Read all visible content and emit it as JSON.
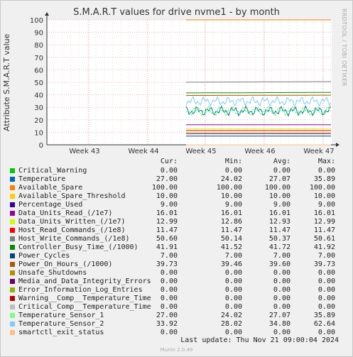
{
  "chart_data": {
    "type": "line",
    "title": "S.M.A.R.T values for drive nvme1 - by month",
    "ylabel": "Attribute S.M.A.R.T value",
    "ylim": [
      0,
      100
    ],
    "yticks": [
      0,
      10,
      20,
      30,
      40,
      50,
      60,
      70,
      80,
      90,
      100
    ],
    "xticks": [
      "Week 43",
      "Week 44",
      "Week 45",
      "Week 46",
      "Week 47"
    ],
    "grid": true,
    "sidelabel": "RRDTOOL / TOBI OETIKER",
    "legend_headers": {
      "cur": "Cur:",
      "min": "Min:",
      "avg": "Avg:",
      "max": "Max:"
    },
    "series": [
      {
        "name": "Critical_Warning",
        "color": "#00cc00",
        "cur": "0.00",
        "min": "0.00",
        "avg": "0.00",
        "max": "0.00"
      },
      {
        "name": "Temperature",
        "color": "#0066b3",
        "cur": "27.00",
        "min": "24.02",
        "avg": "27.07",
        "max": "35.89"
      },
      {
        "name": "Available_Spare",
        "color": "#ff8000",
        "cur": "100.00",
        "min": "100.00",
        "avg": "100.00",
        "max": "100.00"
      },
      {
        "name": "Available_Spare_Threshold",
        "color": "#ffcc00",
        "cur": "10.00",
        "min": "10.00",
        "avg": "10.00",
        "max": "10.00"
      },
      {
        "name": "Percentage_Used",
        "color": "#330099",
        "cur": "9.00",
        "min": "9.00",
        "avg": "9.00",
        "max": "9.00"
      },
      {
        "name": "Data_Units_Read_(/1e7)",
        "color": "#990099",
        "cur": "16.01",
        "min": "16.01",
        "avg": "16.01",
        "max": "16.01"
      },
      {
        "name": "Data_Units_Written_(/1e7)",
        "color": "#ccff00",
        "cur": "12.99",
        "min": "12.86",
        "avg": "12.93",
        "max": "12.99"
      },
      {
        "name": "Host_Read_Commands_(/1e8)",
        "color": "#ff0000",
        "cur": "11.47",
        "min": "11.47",
        "avg": "11.47",
        "max": "11.47"
      },
      {
        "name": "Host_Write_Commands_(/1e8)",
        "color": "#808080",
        "cur": "50.60",
        "min": "50.14",
        "avg": "50.37",
        "max": "50.61"
      },
      {
        "name": "Controller_Busy_Time_(/1000)",
        "color": "#008f00",
        "cur": "41.91",
        "min": "41.52",
        "avg": "41.72",
        "max": "41.92"
      },
      {
        "name": "Power_Cycles",
        "color": "#00487d",
        "cur": "7.00",
        "min": "7.00",
        "avg": "7.00",
        "max": "7.00"
      },
      {
        "name": "Power_On_Hours_(/1000)",
        "color": "#b35a00",
        "cur": "39.73",
        "min": "39.46",
        "avg": "39.60",
        "max": "39.73"
      },
      {
        "name": "Unsafe_Shutdowns",
        "color": "#b38f00",
        "cur": "0.00",
        "min": "0.00",
        "avg": "0.00",
        "max": "0.00"
      },
      {
        "name": "Media_and_Data_Integrity_Errors",
        "color": "#6b006b",
        "cur": "0.00",
        "min": "0.00",
        "avg": "0.00",
        "max": "0.00"
      },
      {
        "name": "Error_Information_Log_Entries",
        "color": "#8fb300",
        "cur": "0.00",
        "min": "0.00",
        "avg": "0.00",
        "max": "0.00"
      },
      {
        "name": "Warning__Comp__Temperature_Time",
        "color": "#b30000",
        "cur": "0.00",
        "min": "0.00",
        "avg": "0.00",
        "max": "0.00"
      },
      {
        "name": "Critical_Comp__Temperature_Time",
        "color": "#bebebe",
        "cur": "0.00",
        "min": "0.00",
        "avg": "0.00",
        "max": "0.00"
      },
      {
        "name": "Temperature_Sensor_1",
        "color": "#80ff80",
        "cur": "27.00",
        "min": "24.02",
        "avg": "27.07",
        "max": "35.89"
      },
      {
        "name": "Temperature_Sensor_2",
        "color": "#80c9ff",
        "cur": "33.92",
        "min": "28.02",
        "avg": "34.80",
        "max": "62.64"
      },
      {
        "name": "smartctl_exit_status",
        "color": "#ffc080",
        "cur": "0.00",
        "min": "0.00",
        "avg": "0.00",
        "max": "0.00"
      }
    ],
    "last_update": "Last update: Thu Nov 21 09:00:04 2024",
    "footer": "Munin 2.0.49"
  }
}
